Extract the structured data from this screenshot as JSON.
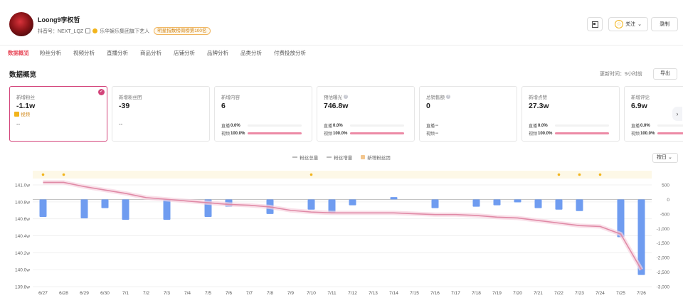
{
  "header": {
    "name": "Loong9李权哲",
    "douyin_id_label": "抖音号：NEXT_LQZ",
    "org": "乐华娱乐集团旗下艺人",
    "rank_badge": "明星指数榜周榜第100名",
    "follow_label": "关注",
    "record_label": "录制"
  },
  "tabs": [
    "数据概览",
    "粉丝分析",
    "视频分析",
    "直播分析",
    "商品分析",
    "店铺分析",
    "品牌分析",
    "品类分析",
    "付费投放分析"
  ],
  "section": {
    "title": "数据概览",
    "update_time": "更新时间：9小时前",
    "export_label": "导出"
  },
  "cards": [
    {
      "label": "新增粉丝",
      "value": "-1.1w",
      "dash": "--",
      "selected": true
    },
    {
      "label": "新增粉丝团",
      "value": "-39",
      "dash": "--"
    },
    {
      "label": "新增内容",
      "value": "6",
      "live": "0.0%",
      "video": "100.0%",
      "video_pct": 100
    },
    {
      "label": "预估曝光",
      "value": "746.8w",
      "live": "0.0%",
      "video": "100.0%",
      "video_pct": 100,
      "help": true
    },
    {
      "label": "总销售额",
      "value": "0",
      "live": "--",
      "video": "--",
      "help": true
    },
    {
      "label": "新增点赞",
      "value": "27.3w",
      "live": "0.0%",
      "video": "100.0%",
      "video_pct": 100
    },
    {
      "label": "新增评论",
      "value": "6.9w",
      "live": "0.0%",
      "video": "100.0%",
      "video_pct": 100
    }
  ],
  "card_row_labels": {
    "live": "直播",
    "video": "视频"
  },
  "chart_data": {
    "type": "bar",
    "legend": [
      "粉丝总量",
      "粉丝增量",
      "新增粉丝团"
    ],
    "day_selector": "按日",
    "event_label": "视频",
    "categories": [
      "6/27",
      "6/28",
      "6/29",
      "6/30",
      "7/1",
      "7/2",
      "7/3",
      "7/4",
      "7/5",
      "7/6",
      "7/7",
      "7/8",
      "7/9",
      "7/10",
      "7/11",
      "7/12",
      "7/13",
      "7/14",
      "7/15",
      "7/16",
      "7/17",
      "7/18",
      "7/19",
      "7/20",
      "7/21",
      "7/22",
      "7/23",
      "7/24",
      "7/25",
      "7/26"
    ],
    "series": [
      {
        "name": "粉丝总量",
        "type": "line",
        "axis": "left",
        "values": [
          141.03,
          141.03,
          140.98,
          140.94,
          140.9,
          140.85,
          140.83,
          140.81,
          140.79,
          140.77,
          140.76,
          140.74,
          140.7,
          140.68,
          140.67,
          140.67,
          140.67,
          140.67,
          140.66,
          140.65,
          140.65,
          140.64,
          140.62,
          140.61,
          140.58,
          140.55,
          140.52,
          140.51,
          140.42,
          140.0
        ]
      },
      {
        "name": "粉丝增量",
        "type": "bar",
        "axis": "right",
        "values": [
          -600,
          0,
          -650,
          -300,
          -700,
          0,
          -700,
          0,
          -600,
          -250,
          0,
          -500,
          0,
          -350,
          -450,
          -200,
          0,
          80,
          0,
          -300,
          0,
          -250,
          -200,
          -100,
          -300,
          -350,
          -400,
          0,
          -1300,
          -2600
        ]
      }
    ],
    "video_event_days": [
      "6/27",
      "6/28",
      "7/10",
      "7/22",
      "7/23",
      "7/24"
    ],
    "y_left": {
      "ticks": [
        "141.0w",
        "140.8w",
        "140.6w",
        "140.4w",
        "140.2w",
        "140.0w",
        "139.8w"
      ],
      "range": [
        139.8,
        141.0
      ]
    },
    "y_right": {
      "ticks": [
        "500",
        "0",
        "-500",
        "-1,000",
        "-1,500",
        "-2,000",
        "-2,500",
        "-3,000"
      ],
      "range": [
        -3000,
        500
      ]
    }
  }
}
